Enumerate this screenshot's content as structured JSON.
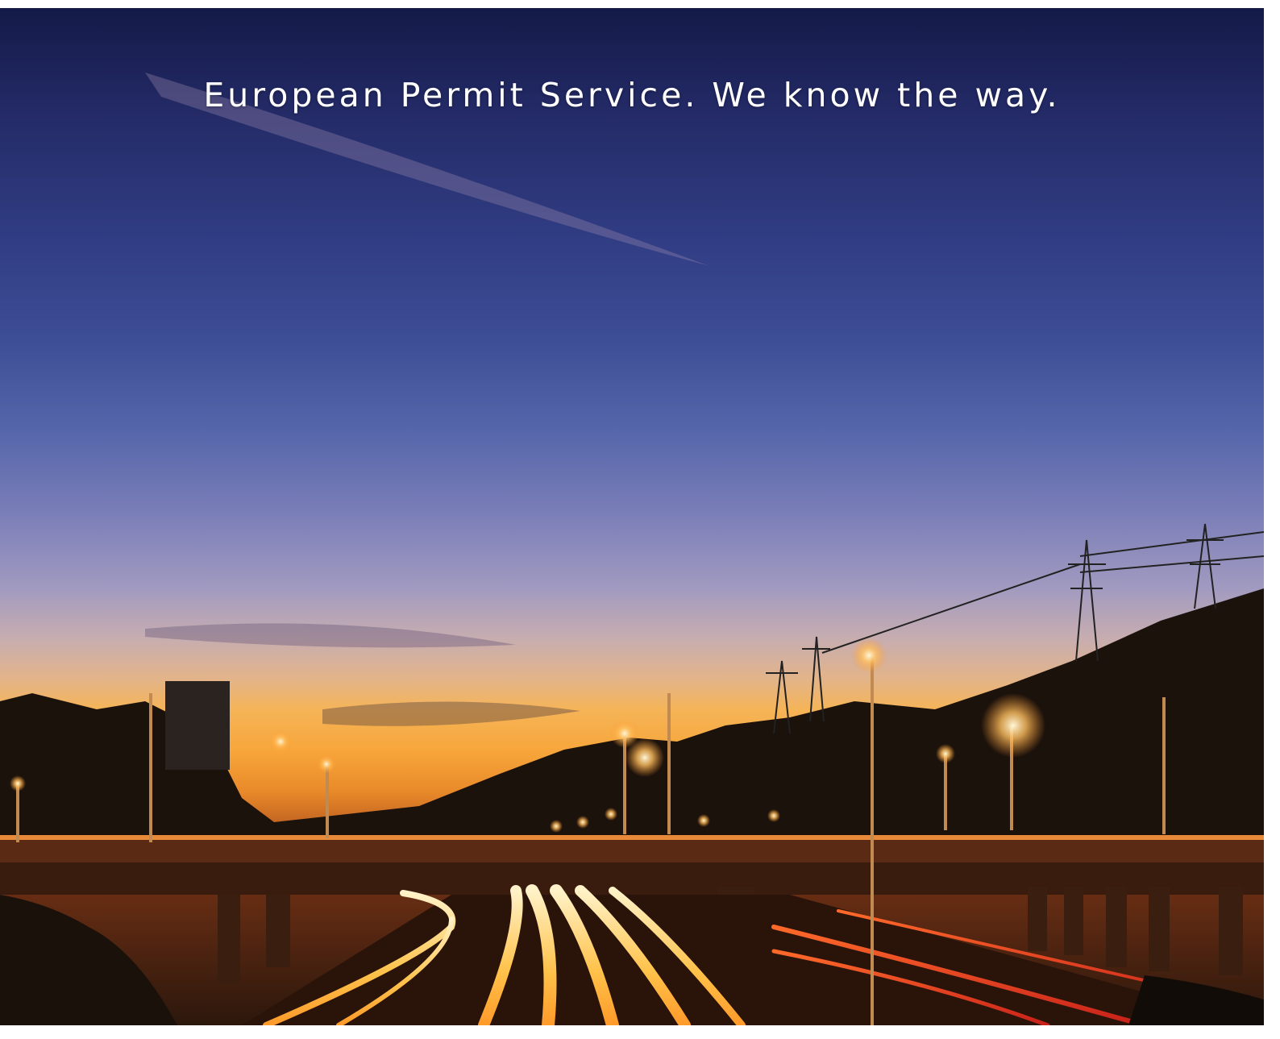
{
  "hero": {
    "tagline": "European Permit Service. We know the way."
  },
  "colors": {
    "sky_top": "#141a47",
    "sky_mid": "#5767ab",
    "horizon": "#f5b457",
    "ground": "#2c170c",
    "light_trail": "#ffd27a"
  }
}
